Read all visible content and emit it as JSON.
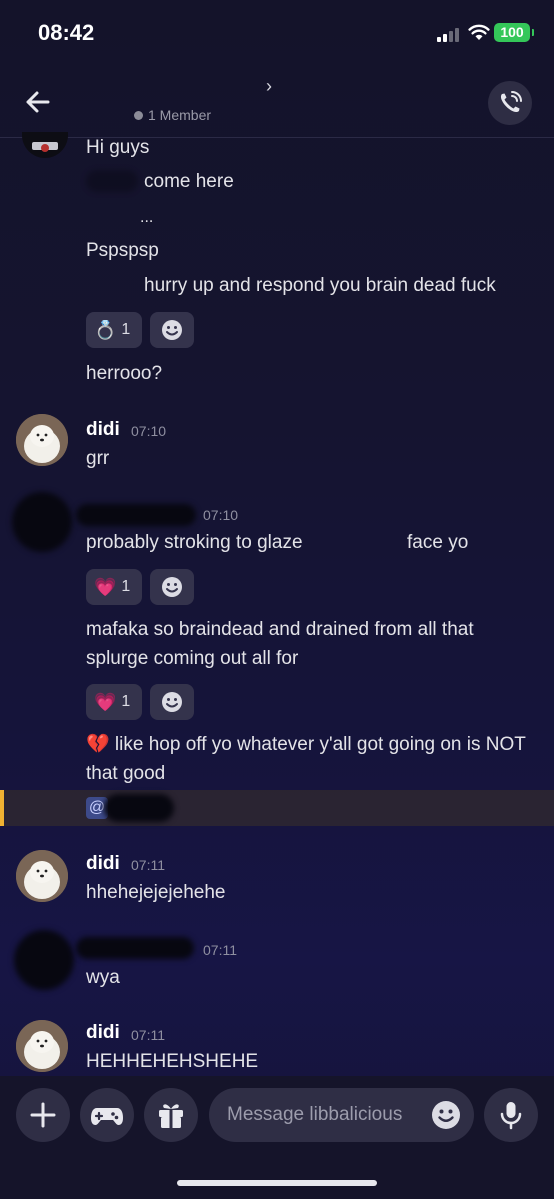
{
  "status_bar": {
    "time": "08:42",
    "battery": "100"
  },
  "header": {
    "member_count": "1 Member",
    "chevron": "›"
  },
  "messages": {
    "m1": "Hi guys",
    "m2": "come here",
    "m3": "...",
    "m4": "Pspspsp",
    "m5": "hurry up and respond you brain dead fuck",
    "m5_reaction": {
      "emoji": "💍",
      "count": "1"
    },
    "m6": "herrooo?",
    "g2": {
      "author": "didi",
      "time": "07:10",
      "text": "grr"
    },
    "g3": {
      "time": "07:10",
      "text_a": "probably stroking to glaze",
      "text_b": "face yo",
      "reaction_1": {
        "emoji": "💗",
        "count": "1"
      },
      "text_2": "mafaka so braindead and drained from all that splurge coming out all for",
      "reaction_2": {
        "emoji": "💗",
        "count": "1"
      },
      "text_3": "💔 like hop off yo whatever y'all got going on is NOT that good",
      "mention": "@"
    },
    "g4": {
      "author": "didi",
      "time": "07:11",
      "text": "hhehejejejehehe"
    },
    "g5": {
      "time": "07:11",
      "text": "wya"
    },
    "g6": {
      "author": "didi",
      "time": "07:11",
      "text": "HEHHEHEHSHEHE"
    }
  },
  "composer": {
    "placeholder": "Message libbalicious"
  },
  "icons": [
    "back-arrow-icon",
    "phone-icon",
    "plus-icon",
    "gamepad-icon",
    "gift-icon",
    "emoji-icon",
    "microphone-icon",
    "add-reaction-icon"
  ],
  "colors": {
    "accent_battery": "#34c759",
    "mention_border": "#f0b232",
    "background": "#151430"
  }
}
